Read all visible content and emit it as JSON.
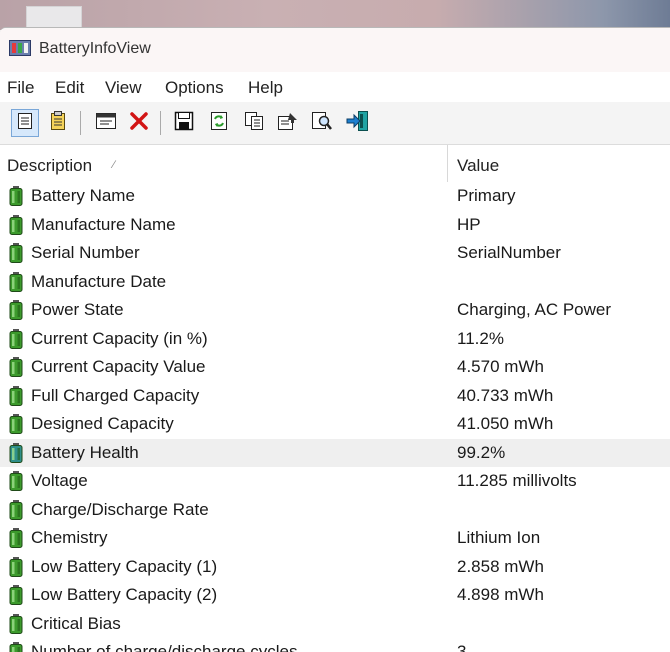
{
  "window": {
    "title": "BatteryInfoView"
  },
  "menu": [
    "File",
    "Edit",
    "View",
    "Options",
    "Help"
  ],
  "toolbar": {
    "buttons": [
      "details-view-icon",
      "clipboard-view-icon",
      "properties-window-icon",
      "delete-icon",
      "save-icon",
      "refresh-icon",
      "copy-icon",
      "properties-icon",
      "find-icon",
      "exit-icon"
    ]
  },
  "columns": {
    "description": "Description",
    "value": "Value"
  },
  "colors": {
    "battery": "#3c9a2c",
    "selected_row": "#efefef",
    "delete": "#d21414"
  },
  "rows": [
    {
      "description": "Battery Name",
      "value": "Primary"
    },
    {
      "description": "Manufacture Name",
      "value": "HP"
    },
    {
      "description": "Serial Number",
      "value": "SerialNumber"
    },
    {
      "description": "Manufacture Date",
      "value": ""
    },
    {
      "description": "Power State",
      "value": "Charging, AC Power"
    },
    {
      "description": "Current Capacity (in %)",
      "value": "11.2%"
    },
    {
      "description": "Current Capacity Value",
      "value": "4.570 mWh"
    },
    {
      "description": "Full Charged Capacity",
      "value": "40.733 mWh"
    },
    {
      "description": "Designed Capacity",
      "value": "41.050 mWh"
    },
    {
      "description": "Battery Health",
      "value": "99.2%"
    },
    {
      "description": "Voltage",
      "value": "11.285 millivolts"
    },
    {
      "description": "Charge/Discharge Rate",
      "value": ""
    },
    {
      "description": "Chemistry",
      "value": "Lithium Ion"
    },
    {
      "description": "Low Battery Capacity (1)",
      "value": "2.858 mWh"
    },
    {
      "description": "Low Battery Capacity (2)",
      "value": "4.898 mWh"
    },
    {
      "description": "Critical Bias",
      "value": ""
    },
    {
      "description": "Number of charge/discharge cycles",
      "value": "3"
    }
  ]
}
